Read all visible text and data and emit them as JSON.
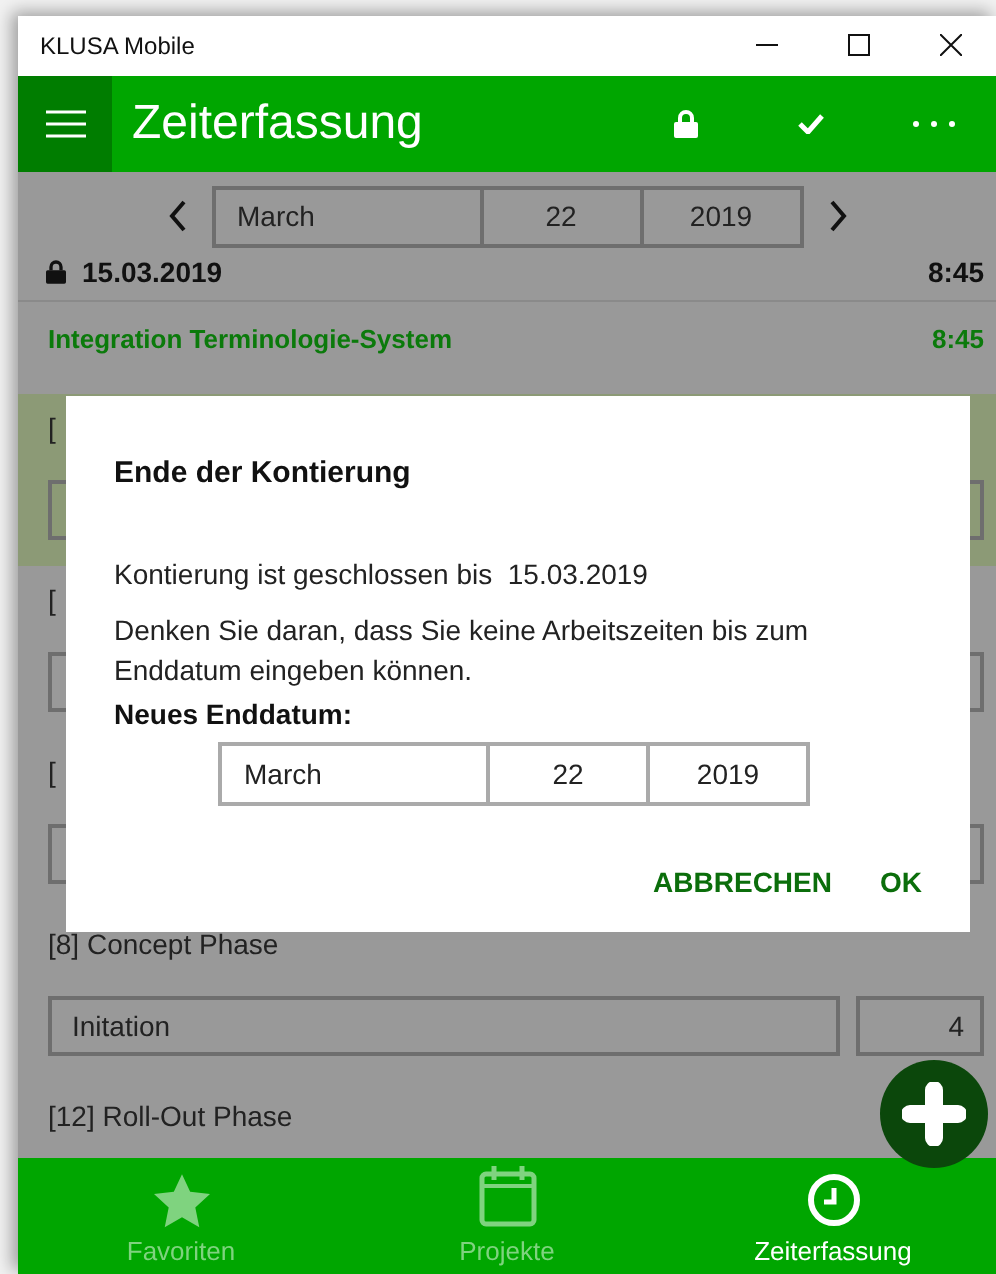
{
  "window": {
    "title": "KLUSA Mobile"
  },
  "header": {
    "title": "Zeiterfassung"
  },
  "date_picker": {
    "month": "March",
    "day": "22",
    "year": "2019"
  },
  "day": {
    "date": "15.03.2019",
    "locked": true,
    "total": "8:45"
  },
  "project": {
    "name": "Integration Terminologie-System",
    "total": "8:45"
  },
  "entries": [
    {
      "kind": "field",
      "label": "[",
      "selected": true
    },
    {
      "kind": "field",
      "label": "[",
      "selected": false
    },
    {
      "kind": "field",
      "label": "[",
      "selected": false
    },
    {
      "kind": "field",
      "label": "[8] Concept Phase",
      "selected": false,
      "activity": "Initation",
      "hours": "4"
    },
    {
      "kind": "label",
      "label": "[12] Roll-Out Phase",
      "selected": false
    }
  ],
  "dialog": {
    "title": "Ende der Kontierung",
    "message": "Kontierung ist geschlossen bis  15.03.2019",
    "note": "Denken Sie daran, dass Sie keine Arbeitszeiten bis zum Enddatum eingeben können.",
    "field_label": "Neues Enddatum:",
    "date": {
      "month": "March",
      "day": "22",
      "year": "2019"
    },
    "buttons": [
      "ABBRECHEN",
      "OK"
    ]
  },
  "nav": [
    {
      "label": "Favoriten",
      "selected": false
    },
    {
      "label": "Projekte",
      "selected": false
    },
    {
      "label": "Zeiterfassung",
      "selected": true
    }
  ]
}
